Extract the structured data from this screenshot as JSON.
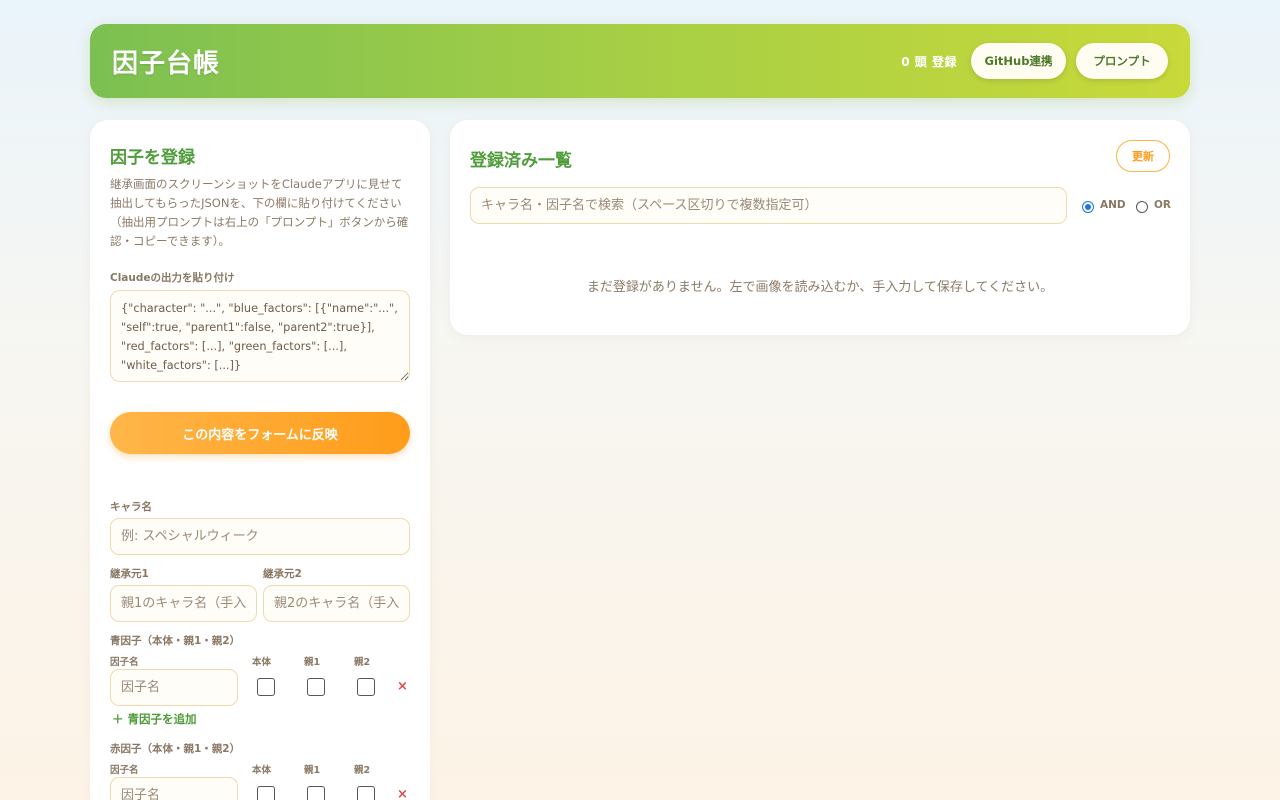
{
  "header": {
    "title": "因子台帳",
    "count": "0 頭 登録",
    "github_label": "GitHub連携",
    "prompt_label": "プロンプト"
  },
  "register": {
    "title": "因子を登録",
    "description": "継承画面のスクリーンショットをClaudeアプリに見せて抽出してもらったJSONを、下の欄に貼り付けてください（抽出用プロンプトは右上の「プロンプト」ボタンから確認・コピーできます）。",
    "paste_label": "Claudeの出力を貼り付け",
    "paste_placeholder": "{\"character\": \"...\", \"blue_factors\": [{\"name\":\"...\", \"self\":true, \"parent1\":false, \"parent2\":true}], \"red_factors\": [...], \"green_factors\": [...], \"white_factors\": [...]}",
    "apply_label": "この内容をフォームに反映",
    "chara_label": "キャラ名",
    "chara_placeholder": "例: スペシャルウィーク",
    "parent1_label": "継承元1",
    "parent1_placeholder": "親1のキャラ名（手入力）",
    "parent2_label": "継承元2",
    "parent2_placeholder": "親2のキャラ名（手入力）",
    "blue": {
      "title": "青因子（本体・親1・親2）",
      "col_name": "因子名",
      "col_self": "本体",
      "col_p1": "親1",
      "col_p2": "親2",
      "name_placeholder": "因子名",
      "remove": "×",
      "add_label": "＋ 青因子を追加"
    },
    "red": {
      "title": "赤因子（本体・親1・親2）",
      "col_name": "因子名",
      "col_self": "本体",
      "col_p1": "親1",
      "col_p2": "親2",
      "name_placeholder": "因子名",
      "remove": "×"
    }
  },
  "list": {
    "title": "登録済み一覧",
    "update_label": "更新",
    "search_placeholder": "キャラ名・因子名で検索（スペース区切りで複数指定可）",
    "and_label": "AND",
    "or_label": "OR",
    "selected_mode": "AND",
    "empty_message": "まだ登録がありません。左で画像を読み込むか、手入力して保存してください。"
  }
}
